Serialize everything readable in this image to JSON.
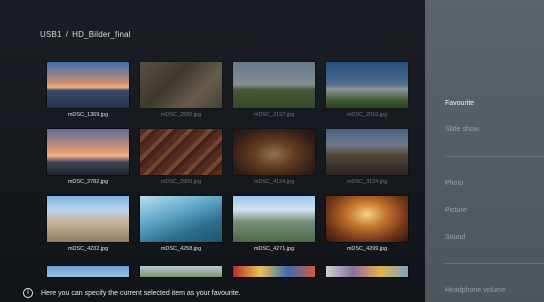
{
  "breadcrumb": {
    "source": "USB1",
    "separator": "/",
    "folder": "HD_Bilder_final"
  },
  "thumbnails": [
    {
      "name": "mDSC_1369.jpg",
      "focused": true
    },
    {
      "name": "mDSC_2580.jpg",
      "focused": false
    },
    {
      "name": "mDSC_2197.jpg",
      "focused": false
    },
    {
      "name": "mDSC_2010.jpg",
      "focused": false
    },
    {
      "name": "mDSC_2782.jpg",
      "focused": true
    },
    {
      "name": "mDSC_2909.jpg",
      "focused": false
    },
    {
      "name": "mDSC_4124.jpg",
      "focused": false
    },
    {
      "name": "mDSC_3124.jpg",
      "focused": false
    },
    {
      "name": "mDSC_4232.jpg",
      "focused": true
    },
    {
      "name": "mDSC_4258.jpg",
      "focused": true
    },
    {
      "name": "mDSC_4271.jpg",
      "focused": true
    },
    {
      "name": "mDSC_4299.jpg",
      "focused": true
    }
  ],
  "sidebar": {
    "items": [
      {
        "label": "Favourite",
        "active": true
      },
      {
        "label": "Slide show",
        "active": false
      },
      {
        "label": "Photo",
        "active": false
      },
      {
        "label": "Picture",
        "active": false
      },
      {
        "label": "Sound",
        "active": false
      },
      {
        "label": "Headphone volume",
        "active": false
      }
    ]
  },
  "info": {
    "icon": "info-icon",
    "text": "Here you can specify the current selected item as your favourite."
  }
}
